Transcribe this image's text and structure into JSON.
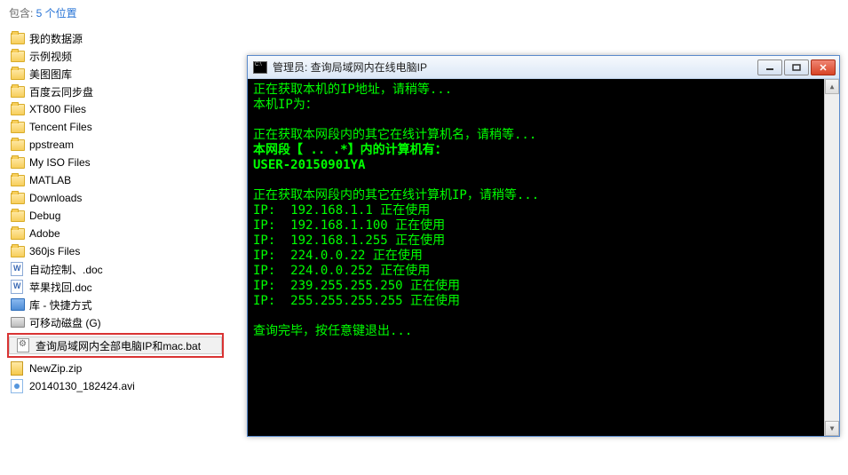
{
  "header": {
    "label_prefix": "包含:  ",
    "count": "5 个位置"
  },
  "files": [
    {
      "icon": "folder",
      "name": "我的数据源"
    },
    {
      "icon": "folder",
      "name": "示例视频"
    },
    {
      "icon": "folder",
      "name": "美图图库"
    },
    {
      "icon": "folder",
      "name": "百度云同步盘"
    },
    {
      "icon": "folder",
      "name": "XT800 Files"
    },
    {
      "icon": "folder",
      "name": "Tencent Files"
    },
    {
      "icon": "folder",
      "name": "ppstream"
    },
    {
      "icon": "folder",
      "name": "My ISO Files"
    },
    {
      "icon": "folder",
      "name": "MATLAB"
    },
    {
      "icon": "folder",
      "name": "Downloads"
    },
    {
      "icon": "folder",
      "name": "Debug"
    },
    {
      "icon": "folder",
      "name": "Adobe"
    },
    {
      "icon": "folder",
      "name": "360js Files"
    },
    {
      "icon": "doc",
      "name": "自动控制、.doc"
    },
    {
      "icon": "doc",
      "name": "苹果找回.doc"
    },
    {
      "icon": "shortcut",
      "name": "库 - 快捷方式"
    },
    {
      "icon": "drive",
      "name": "可移动磁盘 (G)"
    }
  ],
  "highlighted_file": {
    "icon": "bat",
    "name": "查询局域网内全部电脑IP和mac.bat"
  },
  "files_after": [
    {
      "icon": "zip",
      "name": "NewZip.zip"
    },
    {
      "icon": "avi",
      "name": "20140130_182424.avi"
    }
  ],
  "console": {
    "title": "管理员:  查询局域网内在线电脑IP",
    "lines": [
      "正在获取本机的IP地址，请稍等...",
      "本机IP为：",
      "",
      "正在获取本网段内的其它在线计算机名，请稍等...",
      "本网段【 .. .*】内的计算机有：",
      "USER-20150901YA",
      "",
      "正在获取本网段内的其它在线计算机IP，请稍等...",
      "IP:  192.168.1.1 正在使用",
      "IP:  192.168.1.100 正在使用",
      "IP:  192.168.1.255 正在使用",
      "IP:  224.0.0.22 正在使用",
      "IP:  224.0.0.252 正在使用",
      "IP:  239.255.255.250 正在使用",
      "IP:  255.255.255.255 正在使用",
      "",
      "查询完毕，按任意键退出..."
    ]
  }
}
